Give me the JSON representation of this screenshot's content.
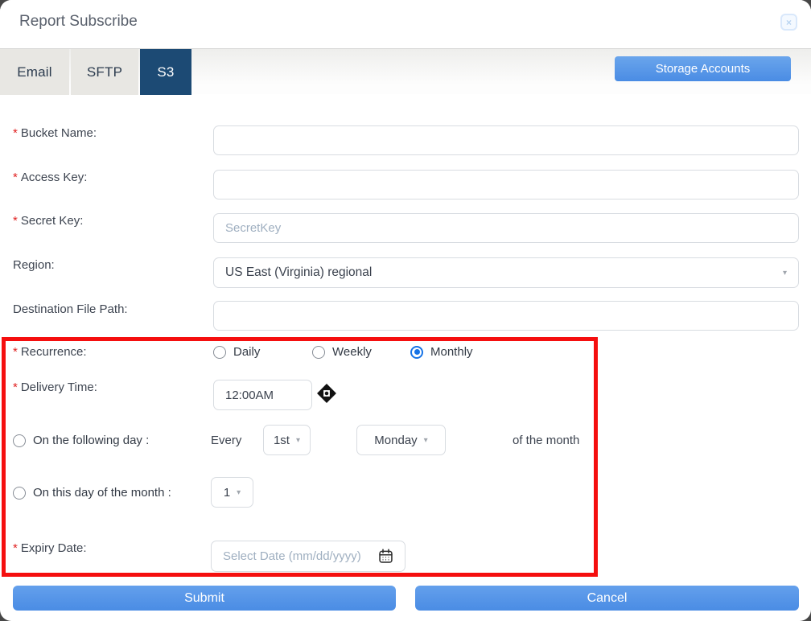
{
  "dialog": {
    "title": "Report Subscribe"
  },
  "icons": {
    "close": "×",
    "caret": "▾"
  },
  "tabs": [
    {
      "label": "Email",
      "active": false
    },
    {
      "label": "SFTP",
      "active": false
    },
    {
      "label": "S3",
      "active": true
    }
  ],
  "storage_accounts_button": "Storage Accounts",
  "required_marker": "*",
  "fields": {
    "bucket": {
      "label": "Bucket Name:",
      "required": true,
      "value": ""
    },
    "access": {
      "label": "Access Key:",
      "required": true,
      "value": ""
    },
    "secret": {
      "label": "Secret Key:",
      "required": true,
      "value": "",
      "placeholder": "SecretKey"
    },
    "region": {
      "label": "Region:",
      "required": false,
      "value": "US East (Virginia) regional"
    },
    "destination": {
      "label": "Destination File Path:",
      "required": false,
      "value": ""
    }
  },
  "recurrence": {
    "label": "Recurrence:",
    "required": true,
    "options": [
      {
        "label": "Daily",
        "selected": false
      },
      {
        "label": "Weekly",
        "selected": false
      },
      {
        "label": "Monthly",
        "selected": true
      }
    ]
  },
  "delivery_time": {
    "label": "Delivery Time:",
    "required": true,
    "value": "12:00AM"
  },
  "following_day": {
    "selected": false,
    "label": "On the following day :",
    "every_label": "Every",
    "ordinal": "1st",
    "weekday": "Monday",
    "suffix": "of the month"
  },
  "day_of_month": {
    "selected": false,
    "label": "On this day of the month :",
    "day": "1"
  },
  "expiry": {
    "label": "Expiry Date:",
    "required": true,
    "placeholder": "Select Date (mm/dd/yyyy)"
  },
  "footer": {
    "submit_label": "Submit",
    "cancel_label": "Cancel"
  },
  "colors": {
    "accent_blue": "#4A90E8",
    "tab_active_bg": "#1C4A74",
    "highlight_red": "#F50F0F",
    "required_red": "#E02020"
  }
}
